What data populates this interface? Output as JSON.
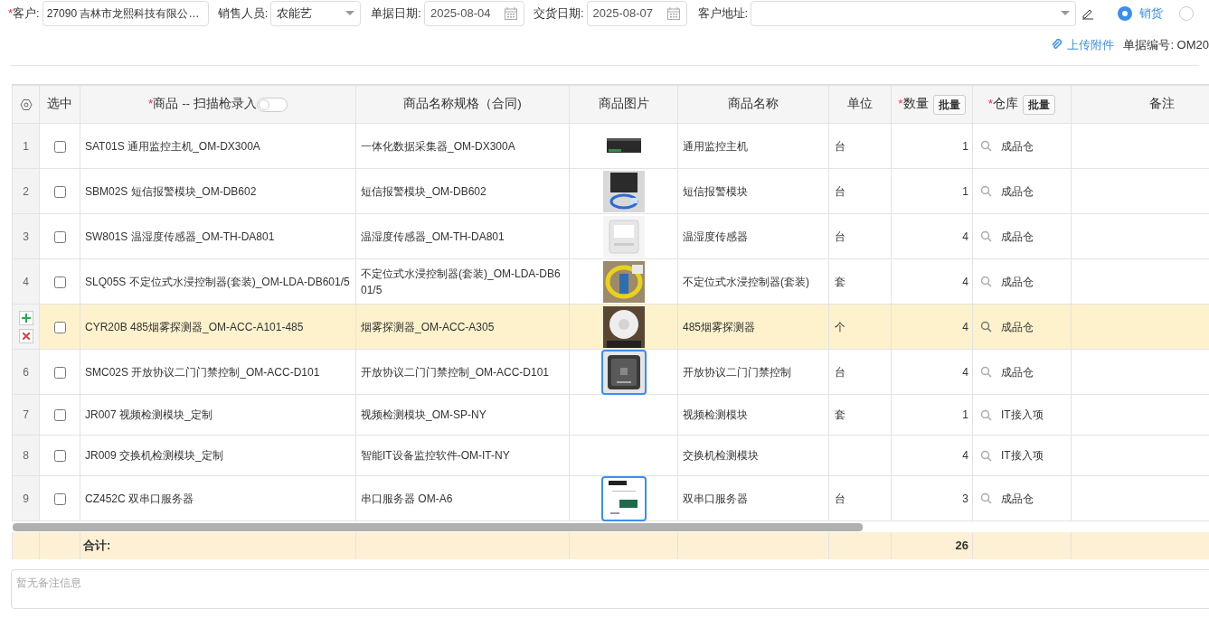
{
  "form": {
    "customer": {
      "label": "客户:",
      "required": "*",
      "value": "27090 吉林市龙熙科技有限公…"
    },
    "salesperson": {
      "label": "销售人员:",
      "value": "农能艺"
    },
    "order_date": {
      "label": "单据日期:",
      "value": "2025-08-04"
    },
    "delivery_date": {
      "label": "交货日期:",
      "value": "2025-08-07"
    },
    "address": {
      "label": "客户地址:"
    },
    "types": [
      {
        "label": "销货",
        "selected": true
      },
      {
        "selected": false
      }
    ],
    "upload": "上传附件",
    "order_no": "单据编号: OM20"
  },
  "table": {
    "columns": [
      {
        "label": "选中"
      },
      {
        "label": "商品 -- 扫描枪录入",
        "required": "*",
        "scanner": {
          "on": false
        }
      },
      {
        "label": "商品名称规格（合同)"
      },
      {
        "label": "商品图片"
      },
      {
        "label": "商品名称"
      },
      {
        "label": "单位"
      },
      {
        "label": "数量",
        "required": "*",
        "batch": "批量"
      },
      {
        "label": "仓库",
        "required": "*",
        "batch": "批量"
      },
      {
        "label": "备注"
      }
    ],
    "rows": [
      {
        "index": "1",
        "checked": false,
        "highlighted": false,
        "product": "SAT01S 通用监控主机_OM-DX300A",
        "spec": "一体化数据采集器_OM-DX300A",
        "image": {
          "kind": "picture",
          "focused": false
        },
        "name": "通用监控主机",
        "unit": "台",
        "qty": "1",
        "warehouse": "成品仓"
      },
      {
        "index": "2",
        "checked": false,
        "highlighted": false,
        "product": "SBM02S 短信报警模块_OM-DB602",
        "spec": "短信报警模块_OM-DB602",
        "image": {
          "kind": "picture",
          "focused": false
        },
        "name": "短信报警模块",
        "unit": "台",
        "qty": "1",
        "warehouse": "成品仓"
      },
      {
        "index": "3",
        "checked": false,
        "highlighted": false,
        "product": "SW801S 温湿度传感器_OM-TH-DA801",
        "spec": "温湿度传感器_OM-TH-DA801",
        "image": {
          "kind": "picture",
          "focused": false
        },
        "name": "温湿度传感器",
        "unit": "台",
        "qty": "4",
        "warehouse": "成品仓"
      },
      {
        "index": "4",
        "checked": false,
        "highlighted": false,
        "product": "SLQ05S 不定位式水浸控制器(套装)_OM-LDA-DB601/5",
        "spec": "不定位式水浸控制器(套装)_OM-LDA-DB601/5",
        "image": {
          "kind": "picture",
          "focused": false
        },
        "name": "不定位式水浸控制器(套装)",
        "unit": "套",
        "qty": "4",
        "warehouse": "成品仓"
      },
      {
        "checked": false,
        "highlighted": true,
        "product": "CYR20B 485烟雾探测器_OM-ACC-A101-485",
        "spec": "烟雾探测器_OM-ACC-A305",
        "image": {
          "kind": "picture",
          "focused": false
        },
        "name": "485烟雾探测器",
        "unit": "个",
        "qty": "4",
        "warehouse": "成品仓"
      },
      {
        "index": "6",
        "checked": false,
        "highlighted": false,
        "product": "SMC02S 开放协议二门门禁控制_OM-ACC-D101",
        "spec": "开放协议二门门禁控制_OM-ACC-D101",
        "image": {
          "kind": "picture",
          "focused": true
        },
        "name": "开放协议二门门禁控制",
        "unit": "台",
        "qty": "4",
        "warehouse": "成品仓"
      },
      {
        "index": "7",
        "checked": false,
        "highlighted": false,
        "product": "JR007 视频检测模块_定制",
        "spec": "视频检测模块_OM-SP-NY",
        "name": "视频检测模块",
        "unit": "套",
        "qty": "1",
        "warehouse": "IT接入项"
      },
      {
        "index": "8",
        "checked": false,
        "highlighted": false,
        "product": "JR009 交换机检测模块_定制",
        "spec": "智能IT设备监控软件-OM-IT-NY",
        "name": "交换机检测模块",
        "qty": "4",
        "warehouse": "IT接入项"
      },
      {
        "index": "9",
        "checked": false,
        "highlighted": false,
        "product": "CZ452C 双串口服务器",
        "spec": "串口服务器 OM-A6",
        "image": {
          "kind": "picture",
          "focused": true
        },
        "name": "双串口服务器",
        "unit": "台",
        "qty": "3",
        "warehouse": "成品仓"
      }
    ],
    "total": {
      "label": "合计:",
      "qty": "26"
    }
  },
  "remarks": {
    "placeholder": "暂无备注信息"
  }
}
